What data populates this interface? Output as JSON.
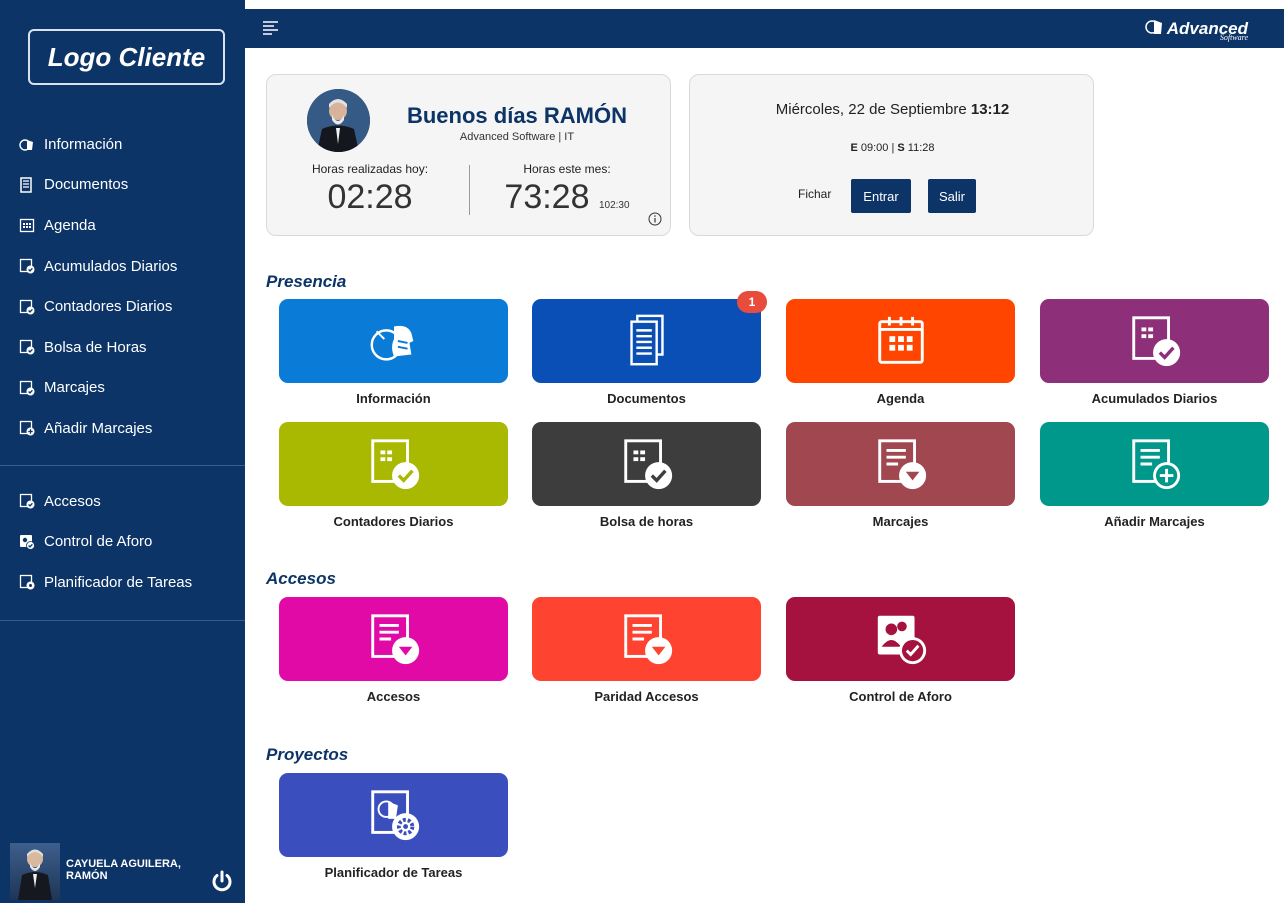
{
  "sidebar": {
    "logo": "Logo Cliente",
    "items": [
      {
        "label": "Información",
        "icon": "advanced-logo-icon"
      },
      {
        "label": "Documentos",
        "icon": "document-icon"
      },
      {
        "label": "Agenda",
        "icon": "calendar-icon"
      },
      {
        "label": "Acumulados Diarios",
        "icon": "calendar-check-icon"
      },
      {
        "label": "Contadores Diarios",
        "icon": "calendar-check-icon"
      },
      {
        "label": "Bolsa de Horas",
        "icon": "calendar-check-icon"
      },
      {
        "label": "Marcajes",
        "icon": "calendar-check-icon"
      },
      {
        "label": "Añadir Marcajes",
        "icon": "calendar-plus-icon"
      },
      {
        "label": "Accesos",
        "icon": "calendar-check-icon"
      },
      {
        "label": "Control de Aforo",
        "icon": "people-check-icon"
      },
      {
        "label": "Planificador de Tareas",
        "icon": "task-gear-icon"
      }
    ],
    "user": {
      "name_line1": "CAYUELA AGUILERA,",
      "name_line2": "RAMÓN"
    }
  },
  "topbar": {
    "brand": "Advanced",
    "brand_sub": "Software"
  },
  "welcome": {
    "greeting": "Buenos días RAMÓN",
    "company": "Advanced Software | IT",
    "hours_today_label": "Horas realizadas hoy:",
    "hours_today": "02:28",
    "hours_month_label": "Horas este mes:",
    "hours_month": "73:28",
    "hours_month_expected": "102:30"
  },
  "clock": {
    "date": "Miércoles, 22 de Septiembre",
    "time": "13:12",
    "entry_label": "E",
    "entry_time": "09:00",
    "exit_label": "S",
    "exit_time": "11:28",
    "fichar_label": "Fichar",
    "entrar_label": "Entrar",
    "salir_label": "Salir"
  },
  "sections": {
    "presencia": "Presencia",
    "accesos": "Accesos",
    "proyectos": "Proyectos"
  },
  "tiles": {
    "informacion": {
      "label": "Información",
      "color": "#0a7bd6"
    },
    "documentos": {
      "label": "Documentos",
      "color": "#0a4fb5",
      "badge": "1"
    },
    "agenda": {
      "label": "Agenda",
      "color": "#ff4500"
    },
    "acumulados": {
      "label": "Acumulados Diarios",
      "color": "#8e2f79"
    },
    "contadores": {
      "label": "Contadores Diarios",
      "color": "#a9b800"
    },
    "bolsa": {
      "label": "Bolsa de horas",
      "color": "#3d3d3d"
    },
    "marcajes": {
      "label": "Marcajes",
      "color": "#a0474f"
    },
    "anadir": {
      "label": "Añadir Marcajes",
      "color": "#00988a"
    },
    "accesos": {
      "label": "Accesos",
      "color": "#e10aa6"
    },
    "paridad": {
      "label": "Paridad Accesos",
      "color": "#ff4331"
    },
    "aforo": {
      "label": "Control de Aforo",
      "color": "#a5123f"
    },
    "planificador": {
      "label": "Planificador de Tareas",
      "color": "#3a4fbd"
    }
  }
}
